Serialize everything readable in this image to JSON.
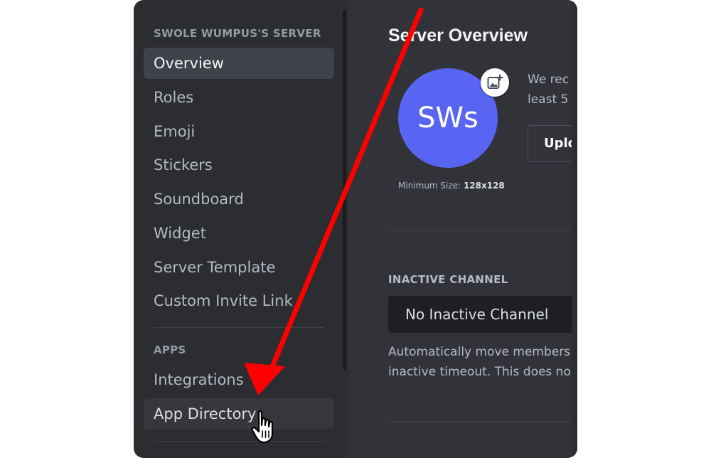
{
  "sidebar": {
    "server_header": "SWOLE WUMPUS'S SERVER",
    "server_items": [
      {
        "label": "Overview",
        "state": "selected"
      },
      {
        "label": "Roles"
      },
      {
        "label": "Emoji"
      },
      {
        "label": "Stickers"
      },
      {
        "label": "Soundboard"
      },
      {
        "label": "Widget"
      },
      {
        "label": "Server Template"
      },
      {
        "label": "Custom Invite Link"
      }
    ],
    "apps_header": "APPS",
    "apps_items": [
      {
        "label": "Integrations"
      },
      {
        "label": "App Directory",
        "state": "hovered"
      }
    ]
  },
  "main": {
    "title": "Server Overview",
    "server_icon_text": "SWs",
    "upload_badge_icon": "image-plus-icon",
    "min_size_label": "Minimum Size:",
    "min_size_value": "128x128",
    "description_line1": "We rec",
    "description_line2": "least 5",
    "upload_button_label": "Uplo",
    "inactive_channel": {
      "label": "INACTIVE CHANNEL",
      "value": "No Inactive Channel",
      "help_line1": "Automatically move members",
      "help_line2": "inactive timeout. This does no"
    }
  },
  "annotation": {
    "arrow_color": "#ff0000",
    "cursor_icon": "hand-pointer-icon"
  },
  "colors": {
    "sidebar_bg": "#2b2d31",
    "main_bg": "#313338",
    "selected_bg": "#404249",
    "accent": "#5865f2",
    "input_bg": "#1e1f22"
  }
}
